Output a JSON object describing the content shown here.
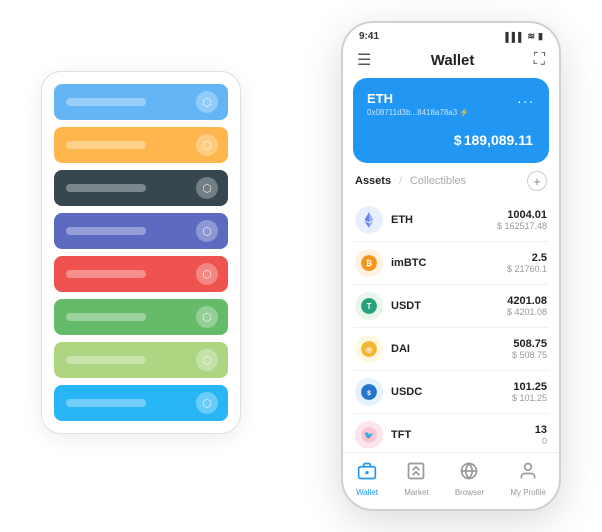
{
  "scene": {
    "back_panel": {
      "cards": [
        {
          "color": "#64B5F6",
          "label_visible": true
        },
        {
          "color": "#FFB74D",
          "label_visible": true
        },
        {
          "color": "#37474F",
          "label_visible": true
        },
        {
          "color": "#5C6BC0",
          "label_visible": true
        },
        {
          "color": "#EF5350",
          "label_visible": true
        },
        {
          "color": "#66BB6A",
          "label_visible": true
        },
        {
          "color": "#AED581",
          "label_visible": true
        },
        {
          "color": "#29B6F6",
          "label_visible": true
        }
      ]
    },
    "phone": {
      "status_bar": {
        "time": "9:41",
        "signal": "▌▌▌",
        "wifi": "◈",
        "battery": "🔋"
      },
      "header": {
        "menu_icon": "☰",
        "title": "Wallet",
        "expand_icon": "⛶"
      },
      "eth_card": {
        "name": "ETH",
        "address": "0x08711d3b...8418a78a3 ⚡",
        "dots": "...",
        "balance_symbol": "$",
        "balance": "189,089.11"
      },
      "assets_section": {
        "tab_active": "Assets",
        "divider": "/",
        "tab_inactive": "Collectibles",
        "add_icon": "+"
      },
      "assets": [
        {
          "symbol": "ETH",
          "icon_bg": "#E8F0FF",
          "icon_char": "♦",
          "icon_color": "#627EEA",
          "amount": "1004.01",
          "usd": "$ 162517.48"
        },
        {
          "symbol": "imBTC",
          "icon_bg": "#FFF3E0",
          "icon_char": "⊙",
          "icon_color": "#F7931A",
          "amount": "2.5",
          "usd": "$ 21760.1"
        },
        {
          "symbol": "USDT",
          "icon_bg": "#E8F5E9",
          "icon_char": "T",
          "icon_color": "#26A17B",
          "amount": "4201.08",
          "usd": "$ 4201.08"
        },
        {
          "symbol": "DAI",
          "icon_bg": "#FFF8E1",
          "icon_char": "◎",
          "icon_color": "#F4B731",
          "amount": "508.75",
          "usd": "$ 508.75"
        },
        {
          "symbol": "USDC",
          "icon_bg": "#E3F2FD",
          "icon_char": "$",
          "icon_color": "#2775CA",
          "amount": "101.25",
          "usd": "$ 101.25"
        },
        {
          "symbol": "TFT",
          "icon_bg": "#FCE4EC",
          "icon_char": "🐦",
          "icon_color": "#E91E63",
          "amount": "13",
          "usd": "0"
        }
      ],
      "bottom_nav": [
        {
          "label": "Wallet",
          "icon": "⬡",
          "active": true
        },
        {
          "label": "Market",
          "icon": "📊",
          "active": false
        },
        {
          "label": "Browser",
          "icon": "👤",
          "active": false
        },
        {
          "label": "My Profile",
          "icon": "👤",
          "active": false
        }
      ]
    }
  }
}
